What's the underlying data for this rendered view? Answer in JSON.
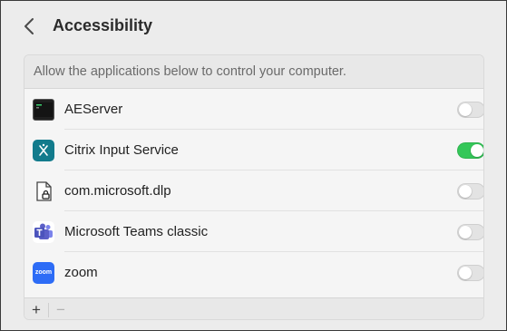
{
  "header": {
    "title": "Accessibility",
    "back_icon": "chevron-left-icon"
  },
  "panel": {
    "description": "Allow the applications below to control your computer.",
    "apps": [
      {
        "name": "AEServer",
        "icon": "terminal-icon",
        "enabled": false
      },
      {
        "name": "Citrix Input Service",
        "icon": "citrix-icon",
        "enabled": true
      },
      {
        "name": "com.microsoft.dlp",
        "icon": "document-lock-icon",
        "enabled": false
      },
      {
        "name": "Microsoft Teams classic",
        "icon": "teams-icon",
        "enabled": false
      },
      {
        "name": "zoom",
        "icon": "zoom-icon",
        "enabled": false
      }
    ],
    "footer": {
      "add_label": "+",
      "remove_label": "−"
    }
  },
  "colors": {
    "toggle_on": "#34c759",
    "toggle_off": "#e3e3e3",
    "citrix": "#127b8c",
    "teams": "#5b5fc7",
    "zoom": "#2d6cf6"
  },
  "icons": {
    "citrix_glyph": "✕",
    "zoom_text": "zoom"
  }
}
